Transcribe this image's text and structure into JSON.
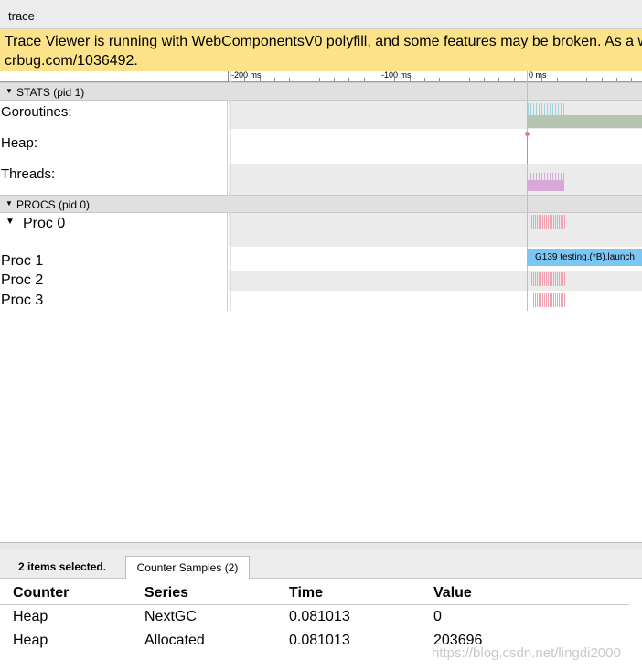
{
  "window": {
    "title": "trace"
  },
  "warning": {
    "line1": "Trace Viewer is running with WebComponentsV0 polyfill, and some features may be broken. As a workaround,",
    "line2": "crbug.com/1036492."
  },
  "ruler": {
    "labels": [
      "-200 ms",
      "-100 ms",
      "0 ms"
    ]
  },
  "stats_group": {
    "label": "STATS (pid 1)",
    "rows": [
      {
        "label": "Goroutines:"
      },
      {
        "label": "Heap:"
      },
      {
        "label": "Threads:"
      }
    ]
  },
  "procs_group": {
    "label": "PROCS (pid 0)",
    "rows": [
      {
        "label": "Proc 0"
      },
      {
        "label": "Proc 1",
        "slice": "G139 testing.(*B).launch"
      },
      {
        "label": "Proc 2"
      },
      {
        "label": "Proc 3"
      }
    ]
  },
  "colors": {
    "warning_bg": "#fce38a",
    "goroutines_spikes": "#9fd0dc",
    "goroutines_bar": "#b4c4b0",
    "heap_marker": "#e87a7a",
    "threads": "#d7a8d8",
    "proc_spikes": "#f3a1b0",
    "slice": "#7cc6f4"
  },
  "bottom_panel": {
    "selection": "2 items selected.",
    "tab": "Counter Samples (2)",
    "table": {
      "headers": [
        "Counter",
        "Series",
        "Time",
        "Value"
      ],
      "rows": [
        [
          "Heap",
          "NextGC",
          "0.081013",
          "0"
        ],
        [
          "Heap",
          "Allocated",
          "0.081013",
          "203696"
        ]
      ]
    }
  },
  "watermark": "https://blog.csdn.net/lingdi2000"
}
